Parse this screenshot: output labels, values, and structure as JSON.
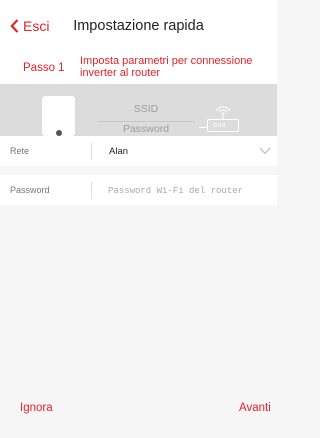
{
  "header": {
    "back_label": "Esci",
    "title": "Impostazione rapida"
  },
  "step": {
    "label": "Passo 1",
    "text": "Imposta parametri per connessione inverter al router"
  },
  "illustration": {
    "ssid": "SSID",
    "password": "Password",
    "router_indicator": "ooo"
  },
  "form": {
    "network": {
      "label": "Rete",
      "value": "Alan"
    },
    "password": {
      "label": "Password",
      "placeholder": "Password Wi-Fi del router"
    }
  },
  "footer": {
    "skip_label": "Ignora",
    "next_label": "Avanti"
  },
  "colors": {
    "accent": "#e5222a",
    "illustration_bg": "#dcdcdc",
    "page_bg": "#f6f6f6"
  },
  "icons": {
    "back": "chevron-left-icon",
    "dropdown": "chevron-down-icon",
    "wifi": "wifi-signal-icon"
  }
}
